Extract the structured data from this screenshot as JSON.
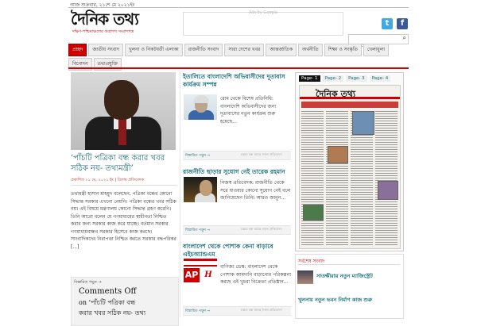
{
  "topbar": {
    "text": "আজ শুক্রবার, ২১শে মে ২০২১ইং"
  },
  "header": {
    "logo_text": "দৈনিক তথ্য",
    "tagline": "দক্ষিণ-পশ্চিমাঞ্চলের অগ্রগণ্য সংবাদপত্র",
    "ad_label": "Ads by Google",
    "social": {
      "twitter": "t",
      "facebook": "f"
    },
    "search_placeholder": "Search..."
  },
  "nav": {
    "row1": [
      "প্রচ্ছদ",
      "জাতীয় সংবাদ",
      "খুলনা ও নিকটবর্তী এলাকা",
      "রাজনীতি সংবাদ",
      "সারা দেশের খবর",
      "আন্তর্জাতিক",
      "অর্থনীতি",
      "শিক্ষা ও সংস্কৃতি",
      "খেলাধুলা"
    ],
    "row2": [
      "বিনোদন",
      "তথ্যপ্রযুক্তি"
    ]
  },
  "featured": {
    "title": "‘পাঁচটি পত্রিকা বন্ধ করার খবর সঠিক নয়- তথ্যমন্ত্রী’",
    "meta": "প্রকাশিত ২১ মে, ২০২১ ইং | বিশেষ প্রতিবেদক",
    "body": "তথ্যমন্ত্রী হাসান মাহমুদ বলেছেন, পত্রিকা বন্ধের কোনো সিদ্ধান্ত সরকার এখনো নেয়নি। পত্রিকা বন্ধের খবর সঠিক নয়। এই বিষয়ে মন্ত্রণালয় কোনো সিদ্ধান্ত গ্রহণ করেনি। তিনি আরো বলেন যে গণমাধ্যমের স্বাধীনতা নিশ্চিত করার জন্য সরকার কাজ করে যাচ্ছে। বর্তমান সরকার গণমাধ্যমবান্ধব সরকার হিসেবে কাজ করছে। সাংবাদিকদের নিরাপত্তা নিশ্চিত করতে সরকার বদ্ধপরিকর [...]",
    "read_more": "বিস্তারিত পড়ুন →",
    "comments_line1": "Comments Off",
    "comments_line2": "on ‘পাঁচটি পত্রিকা বন্ধ",
    "comments_line3": "করার খবর সঠিক নয়- তথ্য"
  },
  "posts": [
    {
      "title": "ইতালিতে বাংলাদেশি অভিবাসীদের দূতাবাস কার্যক্রম সম্পন্ন",
      "text": "রোম থেকে বিশেষ প্রতিনিধি: বাংলাদেশি অভিবাসীদের জন্য দূতাবাসের নতুন কার্যক্রম শুরু হয়েছে…",
      "read_more": "বিস্তারিত পড়ুন →",
      "meta": "মন্তব্য বন্ধ আছে সকল প্রতিবেদন"
    },
    {
      "title": "রাজনীতি ছাড়ার সুযোগ নেই তারেক রহমান",
      "text": "নিজস্ব প্রতিবেদক: রাজনীতি থেকে সরে যাওয়ার কোনো সুযোগ নেই বলে জানিয়েছেন তিনি। আরও জানুন…",
      "read_more": "বিস্তারিত পড়ুন →",
      "meta": "মন্তব্য বন্ধ আছে সকল প্রতিবেদন"
    },
    {
      "title": "বাংলাদেশ থেকে পোশাক কেনা বাড়াবে এইচঅ্যান্ডএম",
      "text": "বাণিজ্য ডেস্ক: বাংলাদেশ থেকে পোশাক আমদানি বাড়ানোর পরিকল্পনা করছে এই খুচরা বিক্রেতা প্রতিষ্ঠান…",
      "read_more": "বিস্তারিত পড়ুন →",
      "meta": "মন্তব্য বন্ধ আছে সকল প্রতিবেদন"
    }
  ],
  "epaper": {
    "tabs": [
      "Page- 1",
      "Page- 2",
      "Page- 3",
      "Page- 4"
    ],
    "masthead": "দৈনিক তথ্য"
  },
  "sidebar": {
    "title": "সর্বশেষ সংবাদ",
    "item1": "সাতক্ষীরায় নতুন ম্যাজিস্ট্রেট",
    "item2": "খুলনায় নতুন ভবন নির্মাণ কাজ শুরু"
  }
}
